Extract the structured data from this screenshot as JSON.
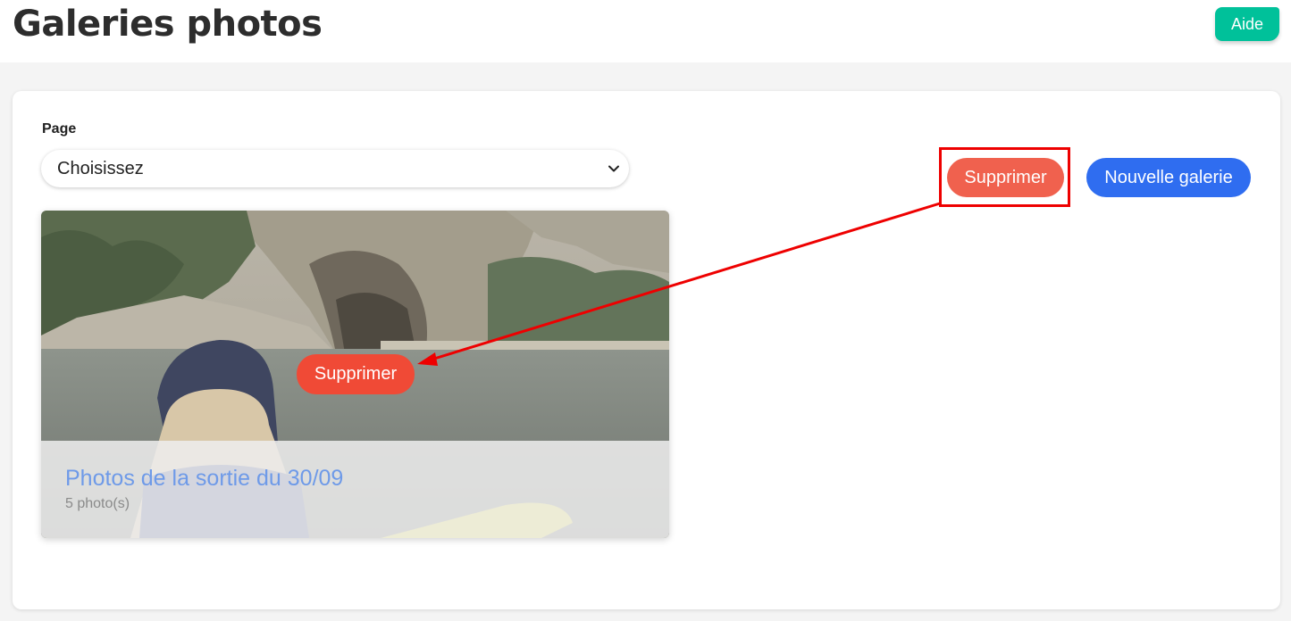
{
  "header": {
    "title": "Galeries photos",
    "help_label": "Aide"
  },
  "filter": {
    "label": "Page",
    "selected": "Choisissez"
  },
  "actions": {
    "delete_label": "Supprimer",
    "new_gallery_label": "Nouvelle galerie"
  },
  "gallery": {
    "title": "Photos de la sortie du 30/09",
    "count": "5 photo(s)",
    "delete_label": "Supprimer"
  },
  "colors": {
    "help": "#00c19a",
    "delete": "#f0614e",
    "primary": "#2f6df0",
    "annotation": "#ee0000"
  },
  "icons": {
    "select": "chevron-down-icon"
  }
}
